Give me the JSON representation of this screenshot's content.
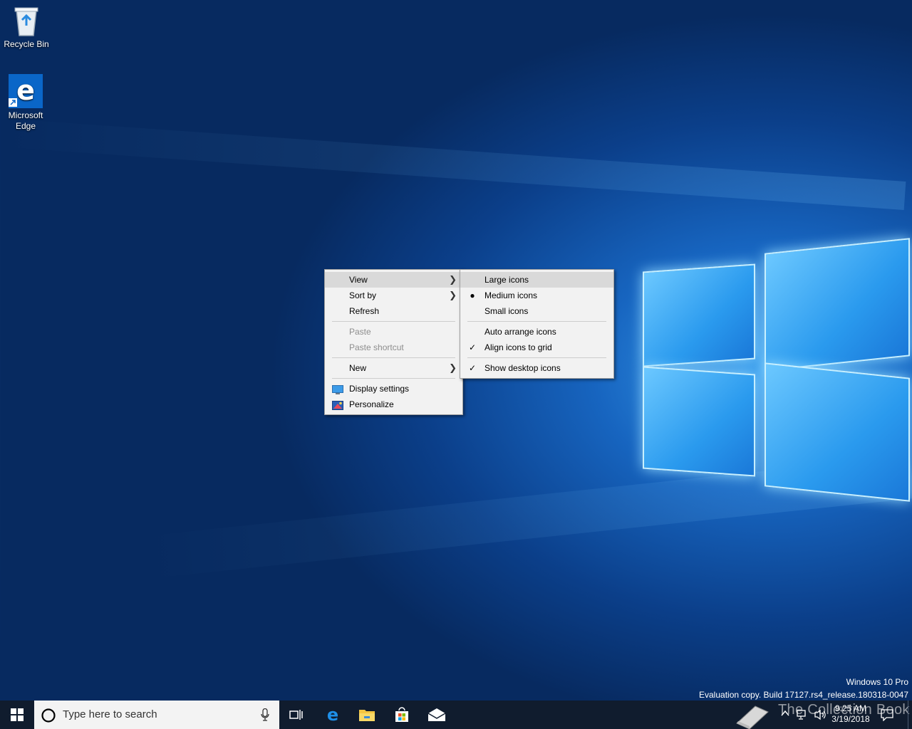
{
  "desktop": {
    "icons": [
      {
        "label": "Recycle Bin",
        "icon": "recycle-bin-icon"
      },
      {
        "label": "Microsoft Edge",
        "icon": "edge-icon"
      }
    ],
    "watermark": {
      "line1": "Windows 10 Pro",
      "line2": "Evaluation copy. Build 17127.rs4_release.180318-0047"
    }
  },
  "context_menu": {
    "view": "View",
    "sort_by": "Sort by",
    "refresh": "Refresh",
    "paste": "Paste",
    "paste_shortcut": "Paste shortcut",
    "new": "New",
    "display_settings": "Display settings",
    "personalize": "Personalize"
  },
  "view_submenu": {
    "large_icons": "Large icons",
    "medium_icons": "Medium icons",
    "small_icons": "Small icons",
    "auto_arrange": "Auto arrange icons",
    "align_to_grid": "Align icons to grid",
    "show_desktop_icons": "Show desktop icons",
    "selected_size": "Medium icons",
    "checked": [
      "Align icons to grid",
      "Show desktop icons"
    ]
  },
  "taskbar": {
    "search_placeholder": "Type here to search",
    "apps": [
      "task-view-icon",
      "edge-icon",
      "file-explorer-icon",
      "store-icon",
      "mail-icon"
    ],
    "time": "9:25 AM",
    "date": "3/19/2018",
    "overlay_text": "The Collection Book"
  },
  "colors": {
    "accent": "#0078d7",
    "taskbar": "#101c2e",
    "menu_bg": "#f2f2f2",
    "menu_highlight": "#d9d9d9"
  }
}
